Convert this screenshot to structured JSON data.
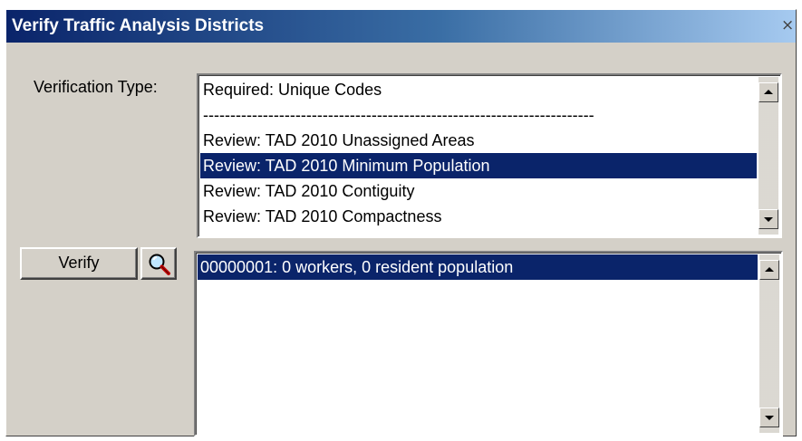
{
  "window": {
    "title": "Verify Traffic Analysis Districts",
    "close_glyph": "×"
  },
  "verification": {
    "label": "Verification Type:",
    "items": [
      "Required: Unique Codes",
      "------------------------------------------------------------------------",
      "Review: TAD 2010 Unassigned Areas",
      "Review: TAD 2010 Minimum Population",
      "Review: TAD 2010 Contiguity",
      "Review: TAD 2010 Compactness"
    ],
    "selected_index": 3
  },
  "actions": {
    "verify_label": "Verify",
    "zoom_icon": "magnifier-icon"
  },
  "results": {
    "items": [
      "00000001: 0 workers, 0 resident population"
    ],
    "selected_index": 0
  },
  "colors": {
    "selection": "#0a246a",
    "dialog_face": "#d4d0c8"
  }
}
